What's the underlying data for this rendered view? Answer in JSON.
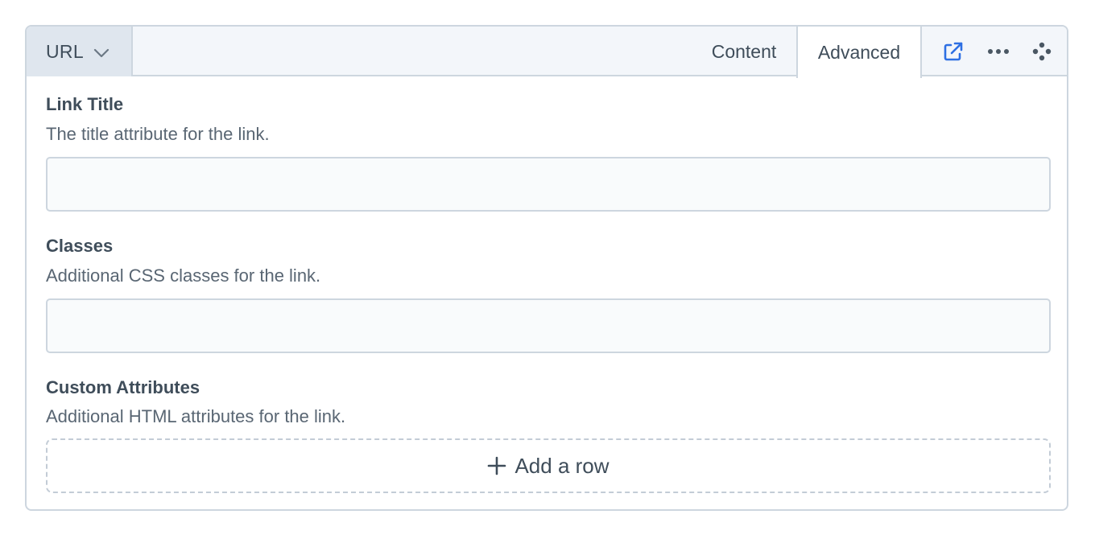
{
  "header": {
    "type_label": "URL",
    "tabs": [
      {
        "label": "Content"
      },
      {
        "label": "Advanced"
      }
    ],
    "active_tab": "Advanced",
    "actions": [
      "open-in-new-window-icon",
      "more-actions-icon",
      "move-drag-icon"
    ],
    "accent_color": "#2d6fe3"
  },
  "fields": {
    "link_title": {
      "label": "Link Title",
      "help": "The title attribute for the link.",
      "value": "",
      "placeholder": ""
    },
    "classes": {
      "label": "Classes",
      "help": "Additional CSS classes for the link.",
      "value": "",
      "placeholder": ""
    },
    "custom_attributes": {
      "label": "Custom Attributes",
      "help": "Additional HTML attributes for the link.",
      "add_row_label": "Add a row"
    }
  }
}
